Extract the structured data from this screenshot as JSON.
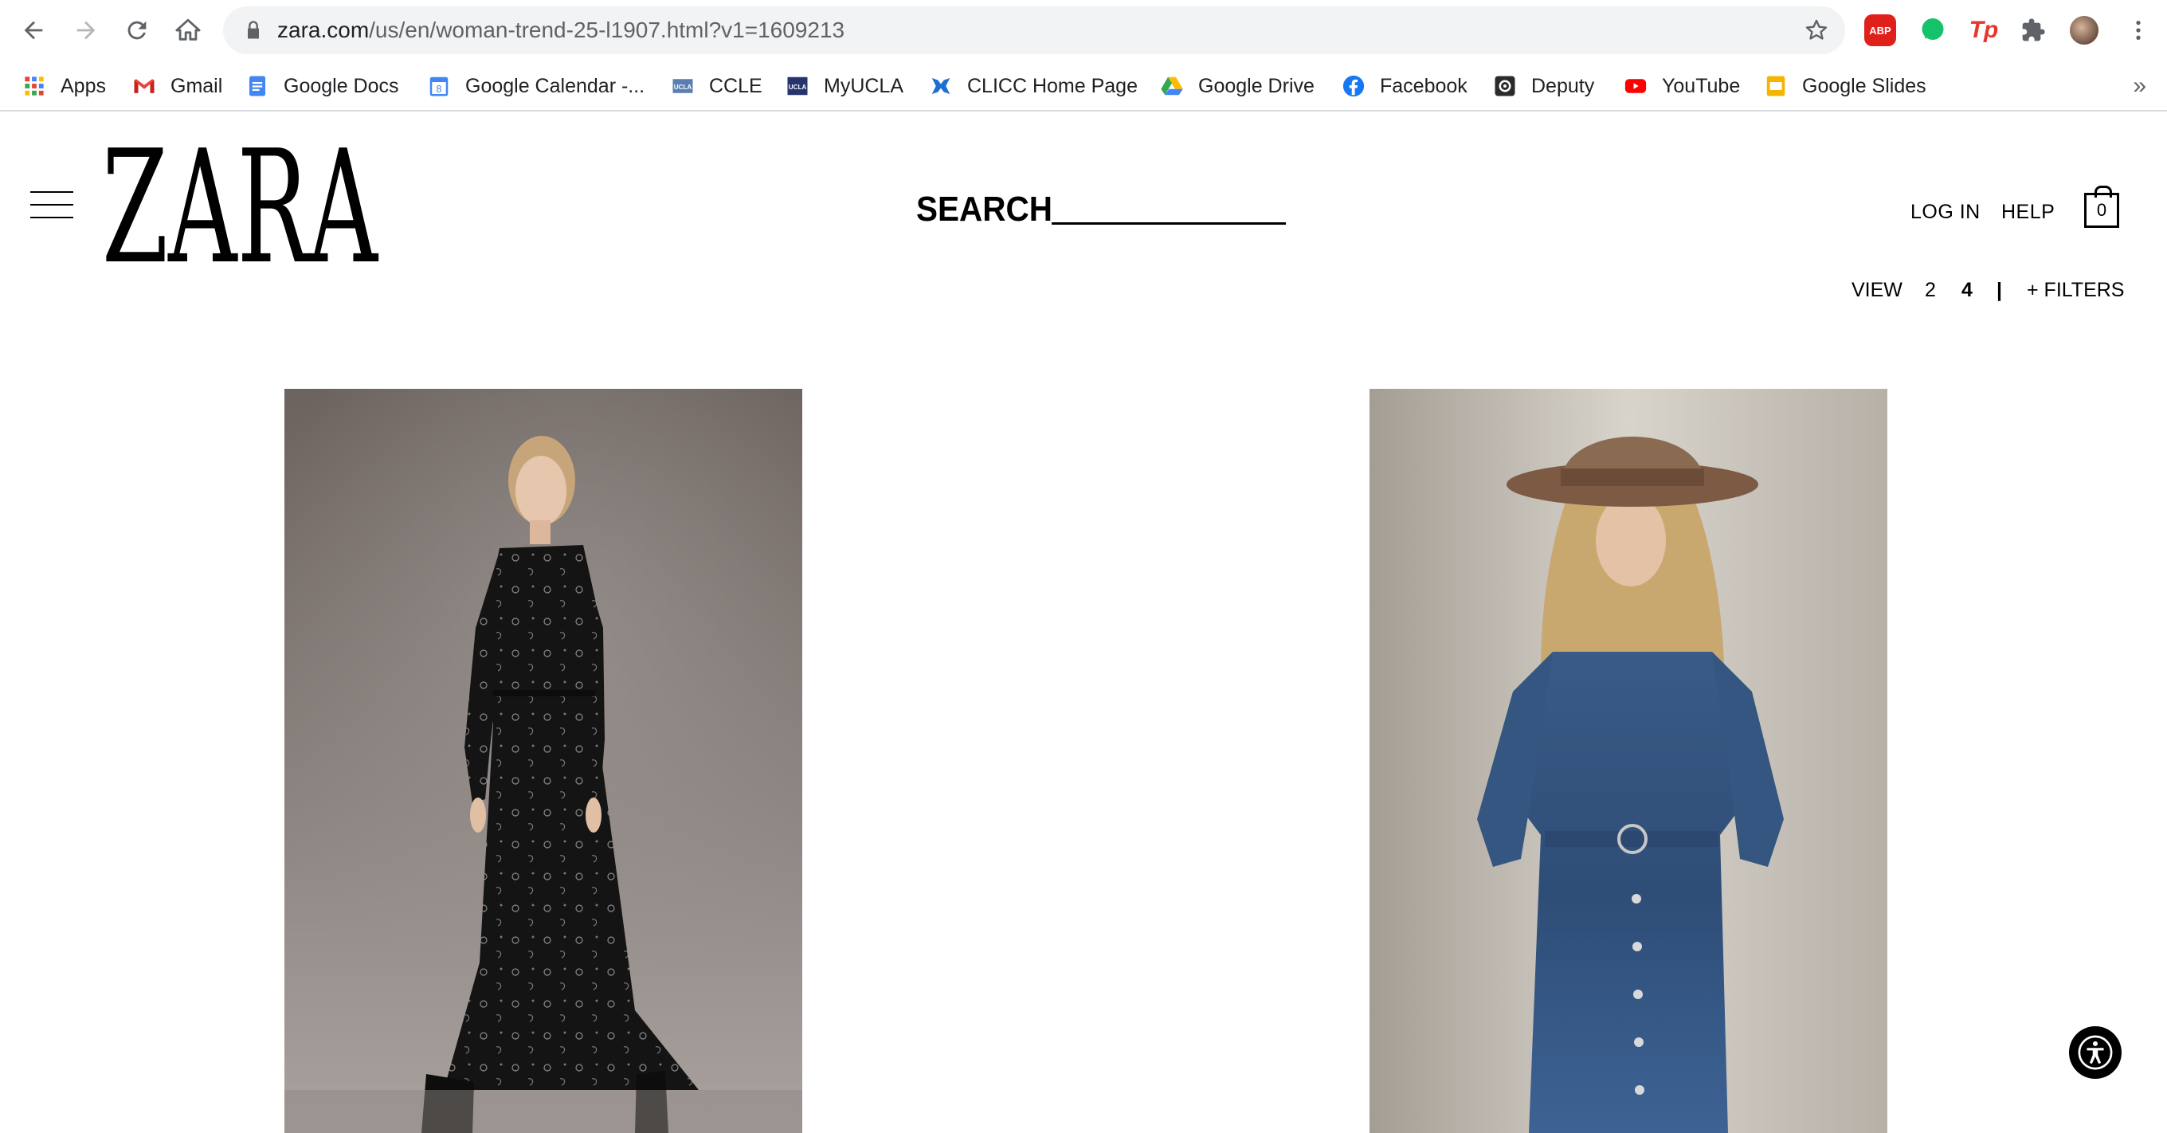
{
  "browser": {
    "url_host": "zara.com",
    "url_path": "/us/en/woman-trend-25-l1907.html?v1=1609213",
    "extensions": [
      "adblock-plus-icon",
      "grammarly-icon",
      "tp-icon",
      "extensions-puzzle-icon",
      "profile-avatar"
    ],
    "ext_abp_label": "ABP",
    "ext_tp_label": "Tp",
    "bookmarks": [
      {
        "label": "Apps",
        "icon": "apps-grid-icon"
      },
      {
        "label": "Gmail",
        "icon": "gmail-icon"
      },
      {
        "label": "Google Docs",
        "icon": "google-docs-icon"
      },
      {
        "label": "Google Calendar -...",
        "icon": "google-calendar-icon"
      },
      {
        "label": "CCLE",
        "icon": "ccle-icon"
      },
      {
        "label": "MyUCLA",
        "icon": "myucla-icon"
      },
      {
        "label": "CLICC Home Page",
        "icon": "clicc-icon"
      },
      {
        "label": "Google Drive",
        "icon": "google-drive-icon"
      },
      {
        "label": "Facebook",
        "icon": "facebook-icon"
      },
      {
        "label": "Deputy",
        "icon": "deputy-icon"
      },
      {
        "label": "YouTube",
        "icon": "youtube-icon"
      },
      {
        "label": "Google Slides",
        "icon": "google-slides-icon"
      }
    ],
    "calendar_day": "8",
    "ucla_badge": "UCLA",
    "bookmarks_overflow": "»"
  },
  "site": {
    "logo": "ZARA",
    "search_label": "SEARCH",
    "login_label": "LOG IN",
    "help_label": "HELP",
    "cart_count": "0",
    "view_label": "VIEW",
    "view_option_2": "2",
    "view_option_4": "4",
    "view_separator": "|",
    "filters_label": "+ FILTERS"
  },
  "products": [
    {
      "image": "model-black-paisley-maxi-dress"
    },
    {
      "image": "model-denim-dress-with-hat"
    }
  ],
  "colors": {
    "text": "#000000",
    "omnibox_bg": "#f1f3f4",
    "chrome_border": "#dadce0"
  }
}
